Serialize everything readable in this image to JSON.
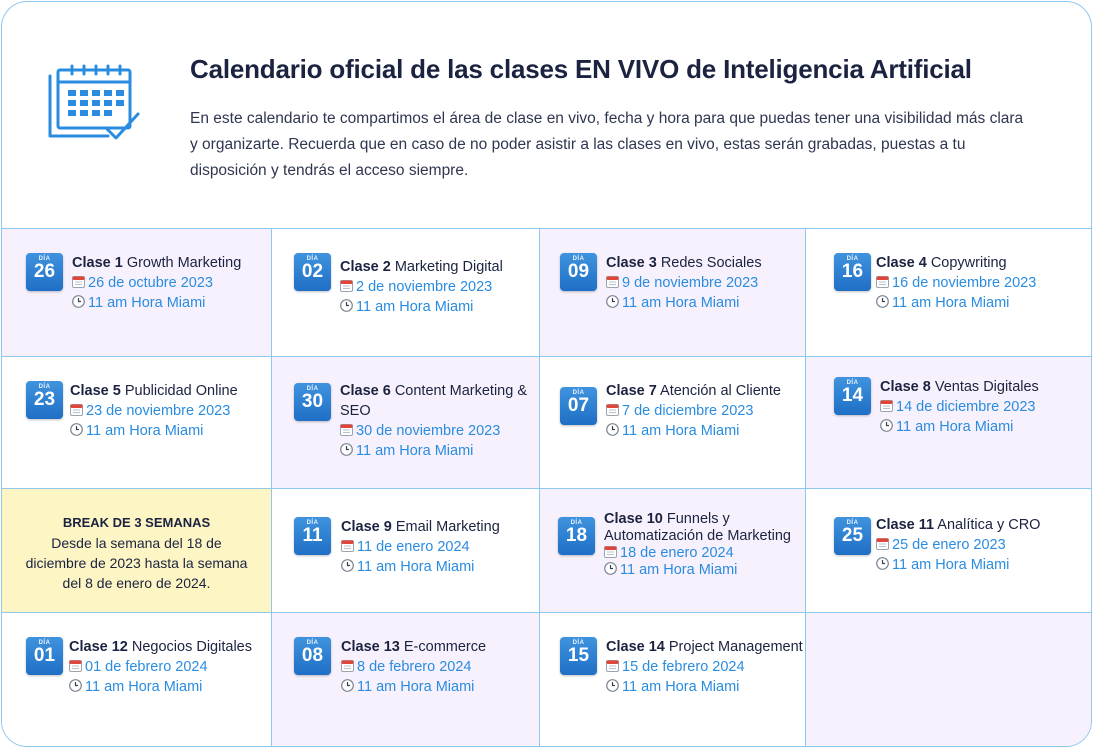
{
  "header": {
    "title": "Calendario oficial de las clases EN VIVO de Inteligencia Artificial",
    "description": "En este calendario te compartimos el área de clase en vivo, fecha y hora para que puedas tener una visibilidad más clara y organizarte. Recuerda que en caso de no poder asistir a las clases en vivo, estas serán grabadas, puestas a tu disposición y tendrás el acceso siempre.",
    "icon": "calendar-icon"
  },
  "day_label": "DÍA",
  "colors": {
    "accent": "#2a8ce0",
    "border": "#8fc7ef",
    "purple": "#f7f1fd",
    "yellow": "#fdf5c4"
  },
  "classes": [
    {
      "day": "26",
      "num": "Clase 1",
      "name": "Growth Marketing",
      "date": "26 de octubre 2023",
      "time": "11 am Hora Miami"
    },
    {
      "day": "02",
      "num": "Clase 2",
      "name": "Marketing Digital",
      "date": "2 de noviembre 2023",
      "time": "11 am Hora Miami"
    },
    {
      "day": "09",
      "num": "Clase 3",
      "name": "Redes Sociales",
      "date": "9 de noviembre 2023",
      "time": "11 am Hora Miami"
    },
    {
      "day": "16",
      "num": "Clase 4",
      "name": "Copywriting",
      "date": "16 de noviembre 2023",
      "time": "11 am Hora Miami"
    },
    {
      "day": "23",
      "num": "Clase 5",
      "name": "Publicidad Online",
      "date": "23 de noviembre 2023",
      "time": "11 am Hora Miami"
    },
    {
      "day": "30",
      "num": "Clase 6",
      "name": "Content Marketing & SEO",
      "date": "30 de noviembre 2023",
      "time": "11 am Hora Miami"
    },
    {
      "day": "07",
      "num": "Clase 7",
      "name": "Atención al Cliente",
      "date": "7 de diciembre 2023",
      "time": "11 am Hora Miami"
    },
    {
      "day": "14",
      "num": "Clase 8",
      "name": "Ventas Digitales",
      "date": "14 de diciembre 2023",
      "time": "11 am Hora Miami"
    },
    {
      "day": "11",
      "num": "Clase 9",
      "name": "Email Marketing",
      "date": "11 de enero 2024",
      "time": "11 am Hora Miami"
    },
    {
      "day": "18",
      "num": "Clase 10",
      "name": "Funnels y Automatización de Marketing",
      "date": "18 de enero 2024",
      "time": "11 am Hora Miami"
    },
    {
      "day": "25",
      "num": "Clase 11",
      "name": "Analítica y CRO",
      "date": "25 de enero 2023",
      "time": "11 am Hora Miami"
    },
    {
      "day": "01",
      "num": "Clase 12",
      "name": "Negocios Digitales",
      "date": "01 de febrero 2024",
      "time": "11 am Hora Miami"
    },
    {
      "day": "08",
      "num": "Clase 13",
      "name": "E-commerce",
      "date": "8 de febrero 2024",
      "time": "11 am Hora Miami"
    },
    {
      "day": "15",
      "num": "Clase 14",
      "name": "Project Management",
      "date": "15 de febrero 2024",
      "time": "11 am Hora Miami"
    }
  ],
  "break_note": {
    "heading": "BREAK DE 3 SEMANAS",
    "text": "Desde la semana del 18 de diciembre de 2023 hasta la semana del 8 de enero de 2024."
  }
}
